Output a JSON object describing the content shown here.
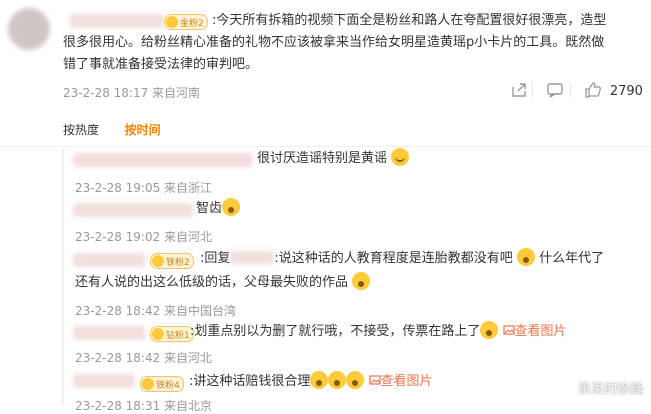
{
  "main": {
    "badge": "金粉2",
    "text_line1": ":今天所有拆箱的视频下面全是粉丝和路人在夸配置很好很漂亮，造型",
    "text_line2": "很多很用心。给粉丝精心准备的礼物不应该被拿来当作给女明星造黄瑶p小卡片的工具。既然做",
    "text_line3": "错了事就准备接受法律的审判吧。",
    "meta": "23-2-28 18:17 来自河南",
    "likes": "2790"
  },
  "sort": {
    "hot": "按热度",
    "time": "按时间"
  },
  "replies": [
    {
      "text": "很讨厌造谣特别是黄谣",
      "meta": "23-2-28 19:05 来自浙江"
    },
    {
      "text": "智齿",
      "meta": "23-2-28 19:02 来自河北"
    },
    {
      "badge": "铁粉2",
      "text_a": ":回复",
      "text_b": ":说这种话的人教育程度是连胎教都没有吧",
      "text_c": "什么年代了",
      "text_line2": "还有人说的出这么低级的话，父母最失败的作品",
      "meta": "23-2-28 18:42 来自中国台湾"
    },
    {
      "badge": "钻粉1",
      "text": ":划重点别以为删了就行哦，不接受，传票在路上了",
      "link": "查看图片",
      "meta": "23-2-28 18:42 来自河北"
    },
    {
      "badge": "铁粉4",
      "text": ":讲这种话赔钱很合理",
      "link": "查看图片",
      "meta": "23-2-28 18:31 来自北京"
    }
  ],
  "watermark": "呆呆的徐巍"
}
